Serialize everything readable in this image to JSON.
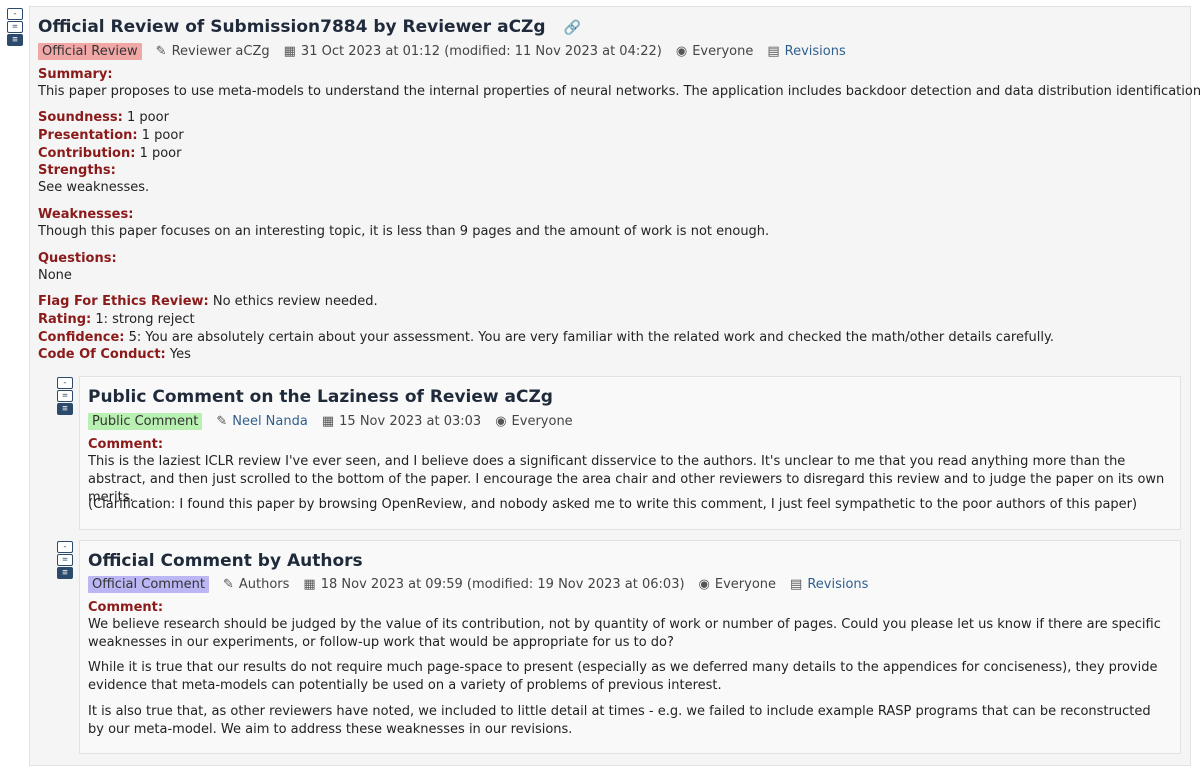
{
  "controls": {
    "collapse": "-",
    "summary": "=",
    "expand": "≡"
  },
  "review": {
    "title": "Official Review of Submission7884 by Reviewer aCZg",
    "link_icon": "link-icon",
    "badge": "Official Review",
    "author": "Reviewer aCZg",
    "date": "31 Oct 2023 at 01:12 (modified: 11 Nov 2023 at 04:22)",
    "visibility": "Everyone",
    "revisions": "Revisions",
    "summary_label": "Summary:",
    "summary": "This paper proposes to use meta-models to understand the internal properties of neural networks. The application includes backdoor detection and data distribution identification.",
    "soundness_label": "Soundness:",
    "soundness": "1 poor",
    "presentation_label": "Presentation:",
    "presentation": "1 poor",
    "contribution_label": "Contribution:",
    "contribution": "1 poor",
    "strengths_label": "Strengths:",
    "strengths": "See weaknesses.",
    "weaknesses_label": "Weaknesses:",
    "weaknesses": "Though this paper focuses on an interesting topic, it is less than 9 pages and the amount of work is not enough.",
    "questions_label": "Questions:",
    "questions": "None",
    "ethics_label": "Flag For Ethics Review:",
    "ethics": "No ethics review needed.",
    "rating_label": "Rating:",
    "rating": "1: strong reject",
    "confidence_label": "Confidence:",
    "confidence": "5: You are absolutely certain about your assessment. You are very familiar with the related work and checked the math/other details carefully.",
    "conduct_label": "Code Of Conduct:",
    "conduct": "Yes"
  },
  "public_comment": {
    "title": "Public Comment on the Laziness of Review aCZg",
    "badge": "Public Comment",
    "author": "Neel Nanda",
    "date": "15 Nov 2023 at 03:03",
    "visibility": "Everyone",
    "comment_label": "Comment:",
    "p1": "This is the laziest ICLR review I've ever seen, and I believe does a significant disservice to the authors. It's unclear to me that you read anything more than the abstract, and then just scrolled to the bottom of the paper. I encourage the area chair and other reviewers to disregard this review and to judge the paper on its own merits.",
    "p2": "(Clarification: I found this paper by browsing OpenReview, and nobody asked me to write this comment, I just feel sympathetic to the poor authors of this paper)"
  },
  "author_comment": {
    "title": "Official Comment by Authors",
    "badge": "Official Comment",
    "author": "Authors",
    "date": "18 Nov 2023 at 09:59 (modified: 19 Nov 2023 at 06:03)",
    "visibility": "Everyone",
    "revisions": "Revisions",
    "comment_label": "Comment:",
    "p1": "We believe research should be judged by the value of its contribution, not by quantity of work or number of pages. Could you please let us know if there are specific weaknesses in our experiments, or follow-up work that would be appropriate for us to do?",
    "p2": "While it is true that our results do not require much page-space to present (especially as we deferred many details to the appendices for conciseness), they provide evidence that meta-models can potentially be used on a variety of problems of previous interest.",
    "p3": "It is also true that, as other reviewers have noted, we included to little detail at times - e.g. we failed to include example RASP programs that can be reconstructed by our meta-model. We aim to address these weaknesses in our revisions."
  }
}
